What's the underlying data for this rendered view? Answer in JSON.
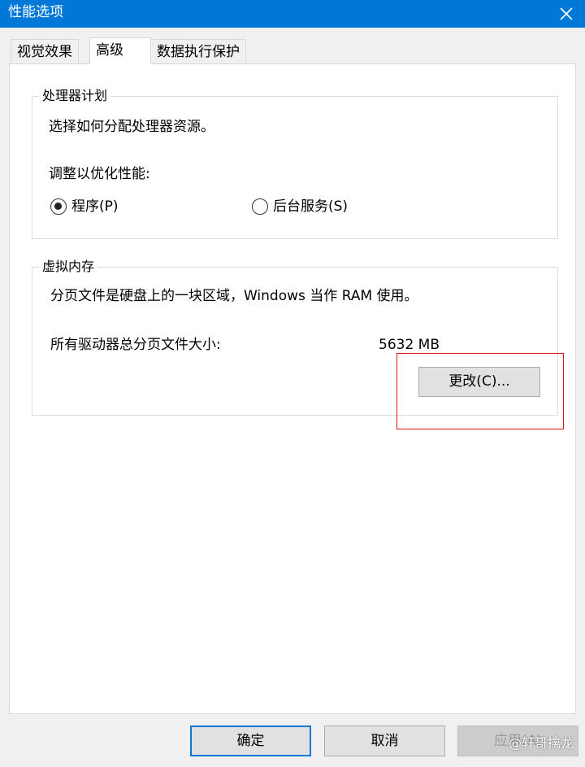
{
  "window": {
    "title": "性能选项"
  },
  "tabs": [
    {
      "label": "视觉效果",
      "active": false
    },
    {
      "label": "高级",
      "active": true
    },
    {
      "label": "数据执行保护",
      "active": false
    }
  ],
  "processor_group": {
    "legend": "处理器计划",
    "description": "选择如何分配处理器资源。",
    "adjust_label": "调整以优化性能:",
    "options": [
      {
        "label": "程序(P)",
        "checked": true
      },
      {
        "label": "后台服务(S)",
        "checked": false
      }
    ]
  },
  "vm_group": {
    "legend": "虚拟内存",
    "description": "分页文件是硬盘上的一块区域，Windows 当作 RAM 使用。",
    "total_label": "所有驱动器总分页文件大小:",
    "total_value": "5632 MB",
    "change_button": "更改(C)..."
  },
  "footer": {
    "ok": "确定",
    "cancel": "取消",
    "apply": "应用(A)"
  },
  "watermark": "@轩哥擒龙",
  "colors": {
    "titlebar": "#0078d7",
    "highlight": "#e0151a"
  }
}
